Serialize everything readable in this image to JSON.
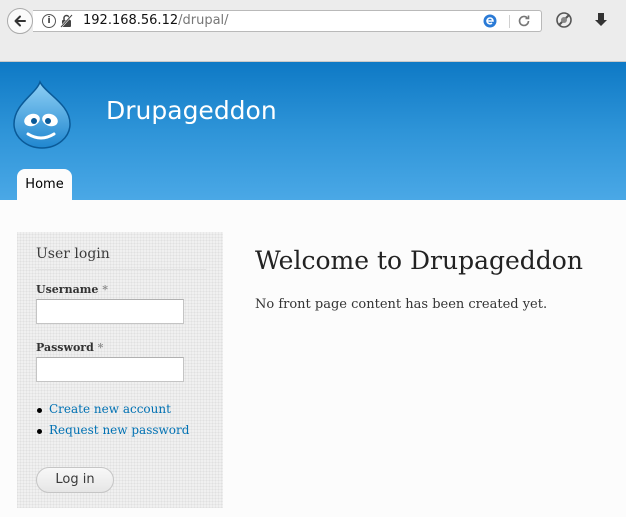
{
  "browser": {
    "url_host": "192.168.56.12",
    "url_path": "/drupal/",
    "info_icon": "info-icon",
    "lock_icon": "insecure-lock-icon",
    "reader_icon": "reader-view-icon",
    "reload_icon": "reload-icon",
    "toolbar_icons": [
      "no-script-icon",
      "download-icon"
    ]
  },
  "header": {
    "site_name": "Drupageddon",
    "logo_icon": "drupal-drop-logo",
    "accent_color": "#0e79c5"
  },
  "nav": {
    "tabs": [
      {
        "label": "Home",
        "active": true
      }
    ]
  },
  "sidebar": {
    "block_title": "User login",
    "username": {
      "label": "Username",
      "required_mark": "*",
      "value": ""
    },
    "password": {
      "label": "Password",
      "required_mark": "*",
      "value": ""
    },
    "links": [
      {
        "label": "Create new account"
      },
      {
        "label": "Request new password"
      }
    ],
    "login_button": "Log in"
  },
  "main": {
    "title": "Welcome to Drupageddon",
    "body": "No front page content has been created yet."
  }
}
